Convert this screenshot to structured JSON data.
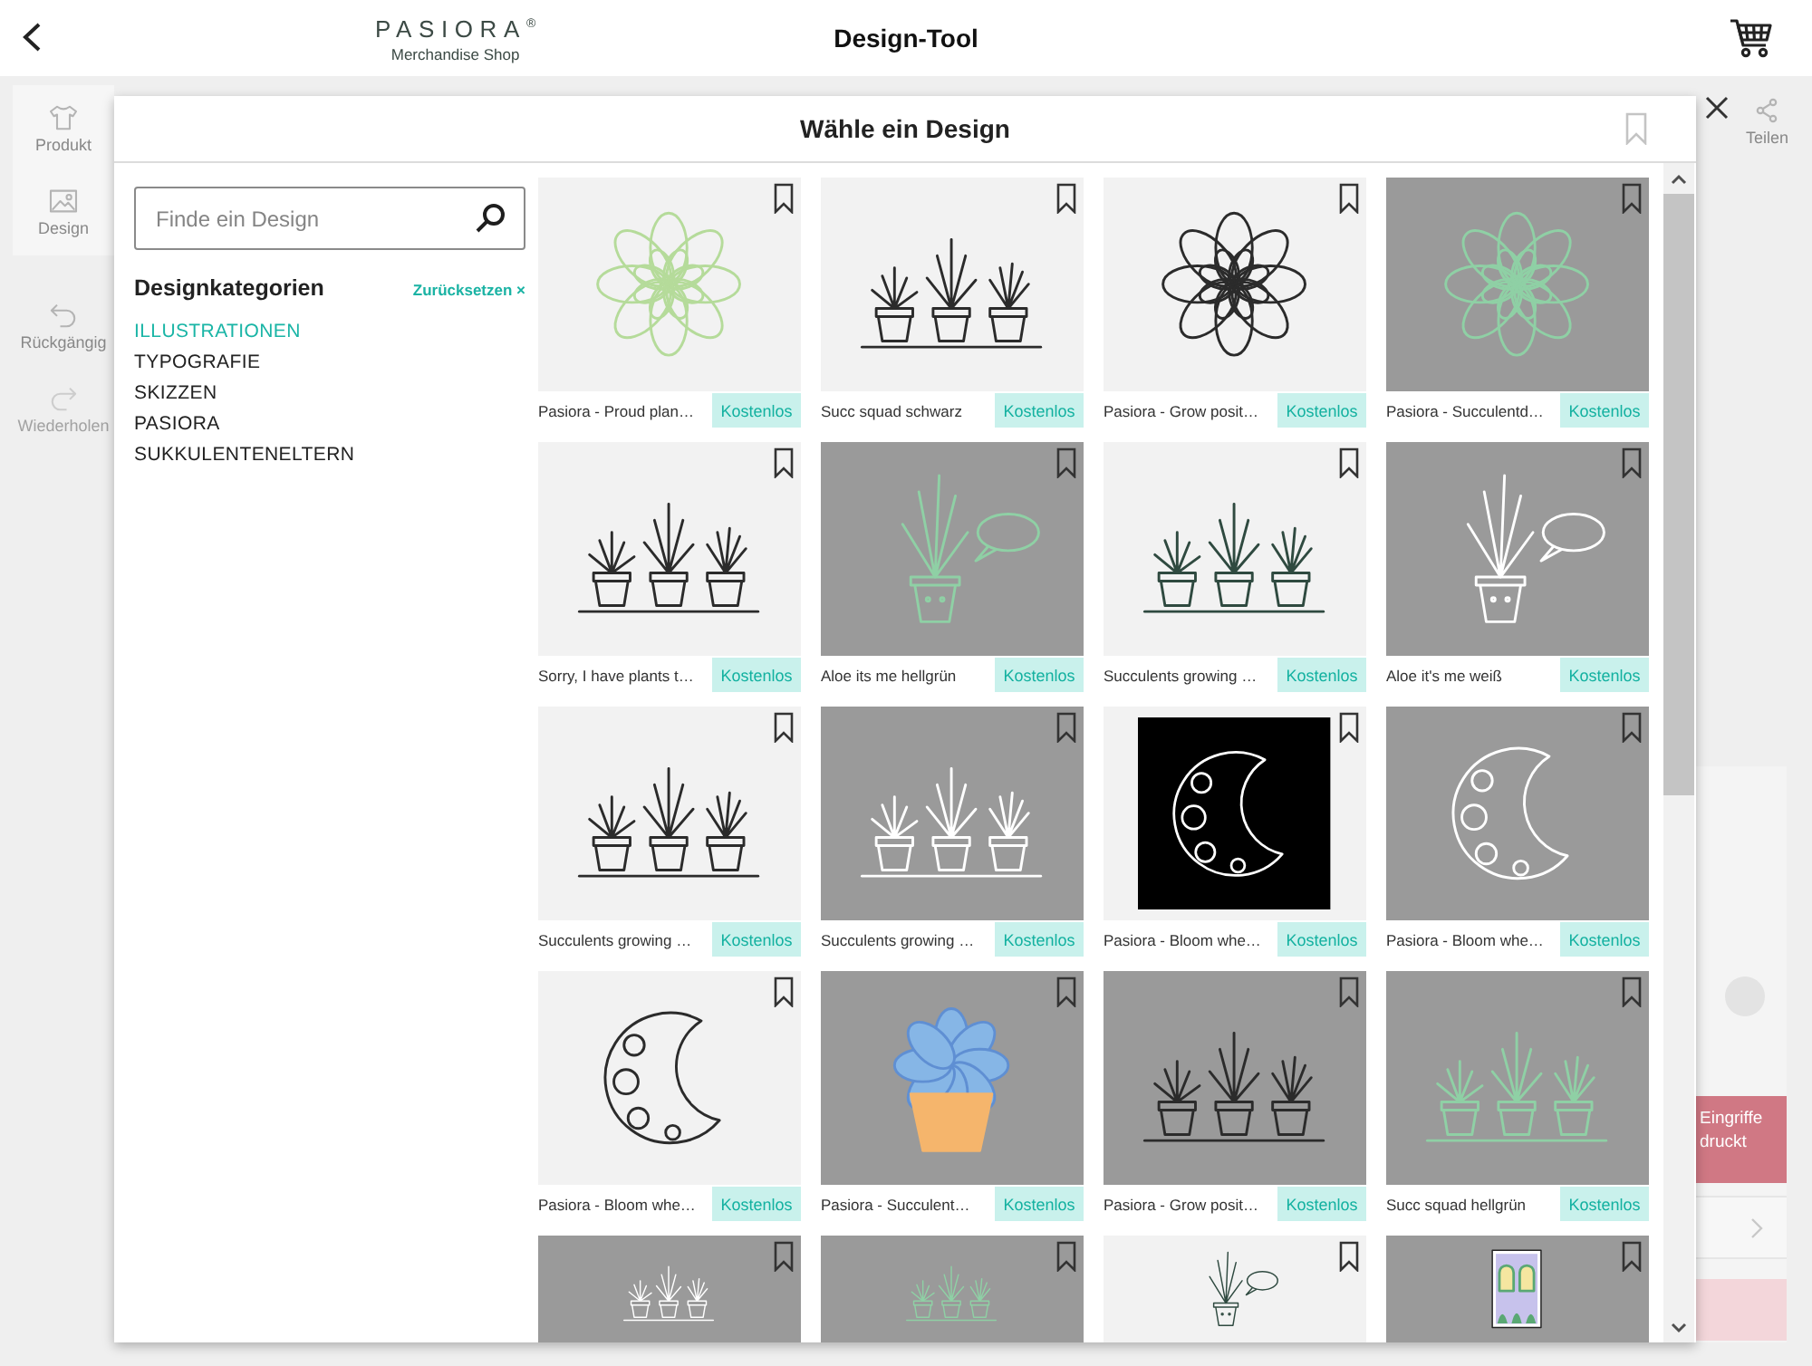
{
  "header": {
    "logo": {
      "wordmark": "PASIORA$^{®}$",
      "tagline": "Merchandise Shop"
    },
    "title": "Design-Tool"
  },
  "editor": {
    "tools": [
      {
        "label": "Produkt",
        "kind": "shirt"
      },
      {
        "label": "Design",
        "kind": "image"
      }
    ],
    "history": [
      {
        "label": "Rückgängig",
        "kind": "undo",
        "disabled": false
      },
      {
        "label": "Wiederholen",
        "kind": "redo",
        "disabled": true
      }
    ],
    "share": {
      "label": "Teilen"
    },
    "notice_lines": [
      "Eingriffe",
      "druckt"
    ]
  },
  "dialog": {
    "title": "Wähle ein Design",
    "search": {
      "placeholder": "Finde ein Design"
    },
    "categories": {
      "heading": "Designkategorien",
      "reset": "Zurücksetzen ×",
      "items": [
        {
          "label": "ILLUSTRATIONEN",
          "selected": true
        },
        {
          "label": "TYPOGRAFIE",
          "selected": false
        },
        {
          "label": "SKIZZEN",
          "selected": false
        },
        {
          "label": "PASIORA",
          "selected": false
        },
        {
          "label": "SUKKULENTENELTERN",
          "selected": false
        }
      ]
    },
    "designs": [
      {
        "title": "Pasiora - Proud plan…",
        "badge": "Kostenlos",
        "bookmarked": false,
        "thumbnail": {
          "kind": "rosette",
          "shaded": false,
          "color": "#b5db9a"
        }
      },
      {
        "title": "Succ squad schwarz",
        "badge": "Kostenlos",
        "bookmarked": false,
        "thumbnail": {
          "kind": "pots",
          "shaded": false,
          "color": "#2b2b2b"
        }
      },
      {
        "title": "Pasiora - Grow posit…",
        "badge": "Kostenlos",
        "bookmarked": false,
        "thumbnail": {
          "kind": "rosette",
          "shaded": false,
          "color": "#2b2b2b"
        }
      },
      {
        "title": "Pasiora - Succulentd…",
        "badge": "Kostenlos",
        "bookmarked": false,
        "thumbnail": {
          "kind": "rosette",
          "shaded": true,
          "color": "#8fd0a5"
        }
      },
      {
        "title": "Sorry, I have plants t…",
        "badge": "Kostenlos",
        "bookmarked": false,
        "thumbnail": {
          "kind": "pots",
          "shaded": false,
          "color": "#2b2b2b"
        }
      },
      {
        "title": "Aloe its me hellgrün",
        "badge": "Kostenlos",
        "bookmarked": false,
        "thumbnail": {
          "kind": "aloe",
          "shaded": true,
          "color": "#8fd0a5"
        }
      },
      {
        "title": "Succulents growing …",
        "badge": "Kostenlos",
        "bookmarked": false,
        "thumbnail": {
          "kind": "pots",
          "shaded": false,
          "color": "#2f4a40"
        }
      },
      {
        "title": "Aloe it's me weiß",
        "badge": "Kostenlos",
        "bookmarked": false,
        "thumbnail": {
          "kind": "aloe",
          "shaded": true,
          "color": "#ffffff"
        }
      },
      {
        "title": "Succulents growing …",
        "badge": "Kostenlos",
        "bookmarked": false,
        "thumbnail": {
          "kind": "pots",
          "shaded": false,
          "color": "#2b2b2b"
        }
      },
      {
        "title": "Succulents growing …",
        "badge": "Kostenlos",
        "bookmarked": false,
        "thumbnail": {
          "kind": "pots",
          "shaded": true,
          "color": "#ffffff"
        }
      },
      {
        "title": "Pasiora - Bloom whe…",
        "badge": "Kostenlos",
        "bookmarked": false,
        "thumbnail": {
          "kind": "moonframe",
          "shaded": false,
          "color": "#ffffff"
        }
      },
      {
        "title": "Pasiora - Bloom whe…",
        "badge": "Kostenlos",
        "bookmarked": false,
        "thumbnail": {
          "kind": "moon",
          "shaded": true,
          "color": "#ffffff"
        }
      },
      {
        "title": "Pasiora - Bloom whe…",
        "badge": "Kostenlos",
        "bookmarked": false,
        "thumbnail": {
          "kind": "moon",
          "shaded": false,
          "color": "#2b2b2b"
        }
      },
      {
        "title": "Pasiora - Succulent…",
        "badge": "Kostenlos",
        "bookmarked": false,
        "thumbnail": {
          "kind": "succulentpot",
          "shaded": true,
          "color": "#5f8fd3"
        }
      },
      {
        "title": "Pasiora - Grow posit…",
        "badge": "Kostenlos",
        "bookmarked": false,
        "thumbnail": {
          "kind": "pots",
          "shaded": true,
          "color": "#2b2b2b"
        }
      },
      {
        "title": "Succ squad hellgrün",
        "badge": "Kostenlos",
        "bookmarked": false,
        "thumbnail": {
          "kind": "pots",
          "shaded": true,
          "color": "#8fd0a5"
        }
      },
      {
        "bookmarked": false,
        "thumbnail": {
          "kind": "pots",
          "shaded": true,
          "color": "#ffffff"
        }
      },
      {
        "bookmarked": false,
        "thumbnail": {
          "kind": "pots",
          "shaded": true,
          "color": "#8fd0a5"
        }
      },
      {
        "bookmarked": false,
        "thumbnail": {
          "kind": "aloe",
          "shaded": false,
          "color": "#2f4a40"
        }
      },
      {
        "bookmarked": false,
        "thumbnail": {
          "kind": "window",
          "shaded": true,
          "color": "#5aa874"
        }
      }
    ]
  }
}
